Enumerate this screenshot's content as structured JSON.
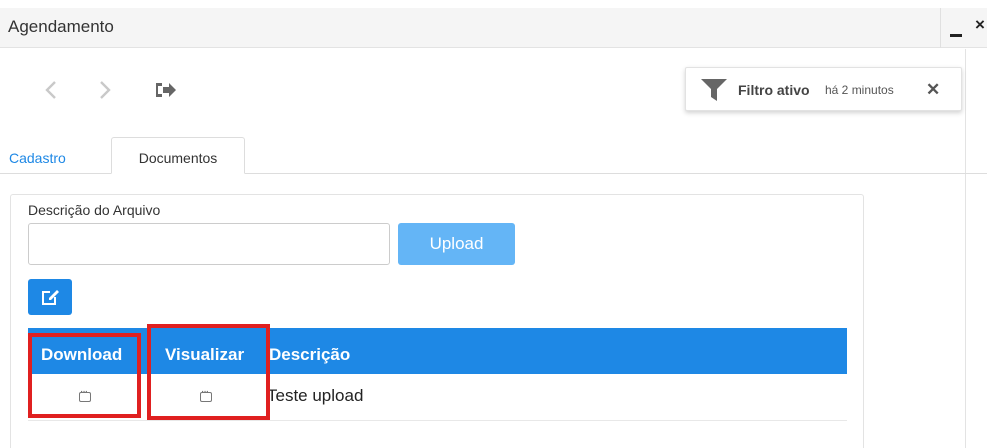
{
  "window": {
    "title": "Agendamento",
    "minimize": "",
    "close": "×"
  },
  "toolbar": {
    "back_icon": "chevron-left-icon",
    "forward_icon": "chevron-right-icon",
    "exit_icon": "sign-out-icon"
  },
  "filter": {
    "icon": "filter-icon",
    "label": "Filtro ativo",
    "time": "há 2 minutos",
    "close": "✕"
  },
  "tabs": [
    {
      "label": "Cadastro",
      "active": false
    },
    {
      "label": "Documentos",
      "active": true
    }
  ],
  "form": {
    "description_label": "Descrição do Arquivo",
    "description_value": "",
    "upload_label": "Upload",
    "edit_icon": "edit-icon"
  },
  "table": {
    "headers": [
      "Download",
      "Visualizar",
      "Descrição"
    ],
    "rows": [
      {
        "download_icon": "ellipsis-icon",
        "view_icon": "ellipsis-icon",
        "description": "Teste upload"
      }
    ]
  },
  "colors": {
    "primary": "#1e88e5",
    "upload_disabled": "#64b5f6",
    "highlight": "#e02020"
  }
}
